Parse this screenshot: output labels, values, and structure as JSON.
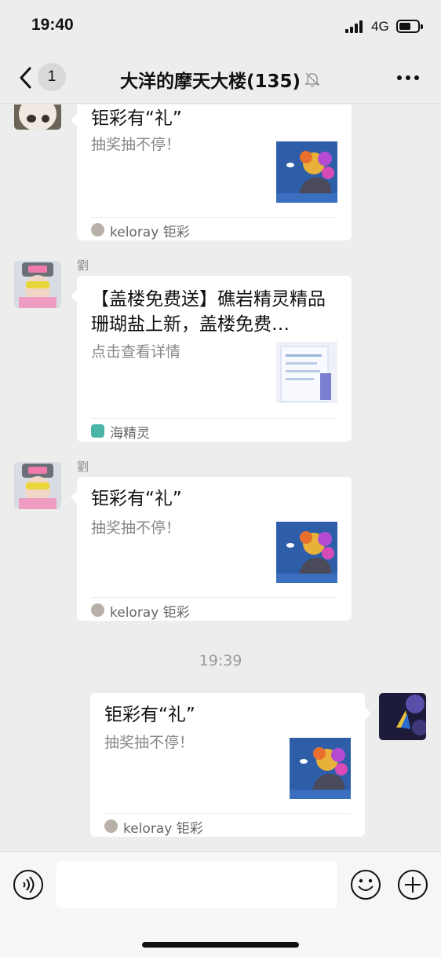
{
  "status_bar": {
    "time": "19:40",
    "network": "4G",
    "icons": [
      "signal-icon",
      "battery-icon"
    ]
  },
  "nav": {
    "back_badge": "1",
    "title": "大洋的摩天大楼(135)",
    "icons": [
      "back-icon",
      "mute-bell-icon",
      "more-icon"
    ]
  },
  "messages": [
    {
      "side": "left",
      "sender": "",
      "title": "钜彩有“礼”",
      "description": "抽奖抽不停！",
      "source": "keloray 钜彩"
    },
    {
      "side": "left",
      "sender": "劉",
      "title": "【盖楼免费送】礁岩精灵精品珊瑚盐上新，盖楼免费…",
      "description": "点击查看详情",
      "source": "海精灵"
    },
    {
      "side": "left",
      "sender": "劉",
      "title": "钜彩有“礼”",
      "description": "抽奖抽不停！",
      "source": "keloray 钜彩"
    },
    {
      "side": "right",
      "sender": "",
      "title": "钜彩有“礼”",
      "description": "抽奖抽不停！",
      "source": "keloray 钜彩"
    }
  ],
  "timestamp": "19:39",
  "input_bar": {
    "placeholder": "",
    "icons": [
      "voice-icon",
      "emoji-icon",
      "plus-icon"
    ]
  },
  "colors": {
    "background": "#ededed",
    "card": "#ffffff",
    "muted_text": "#888888",
    "coral_blue": "#2f5ea8"
  }
}
